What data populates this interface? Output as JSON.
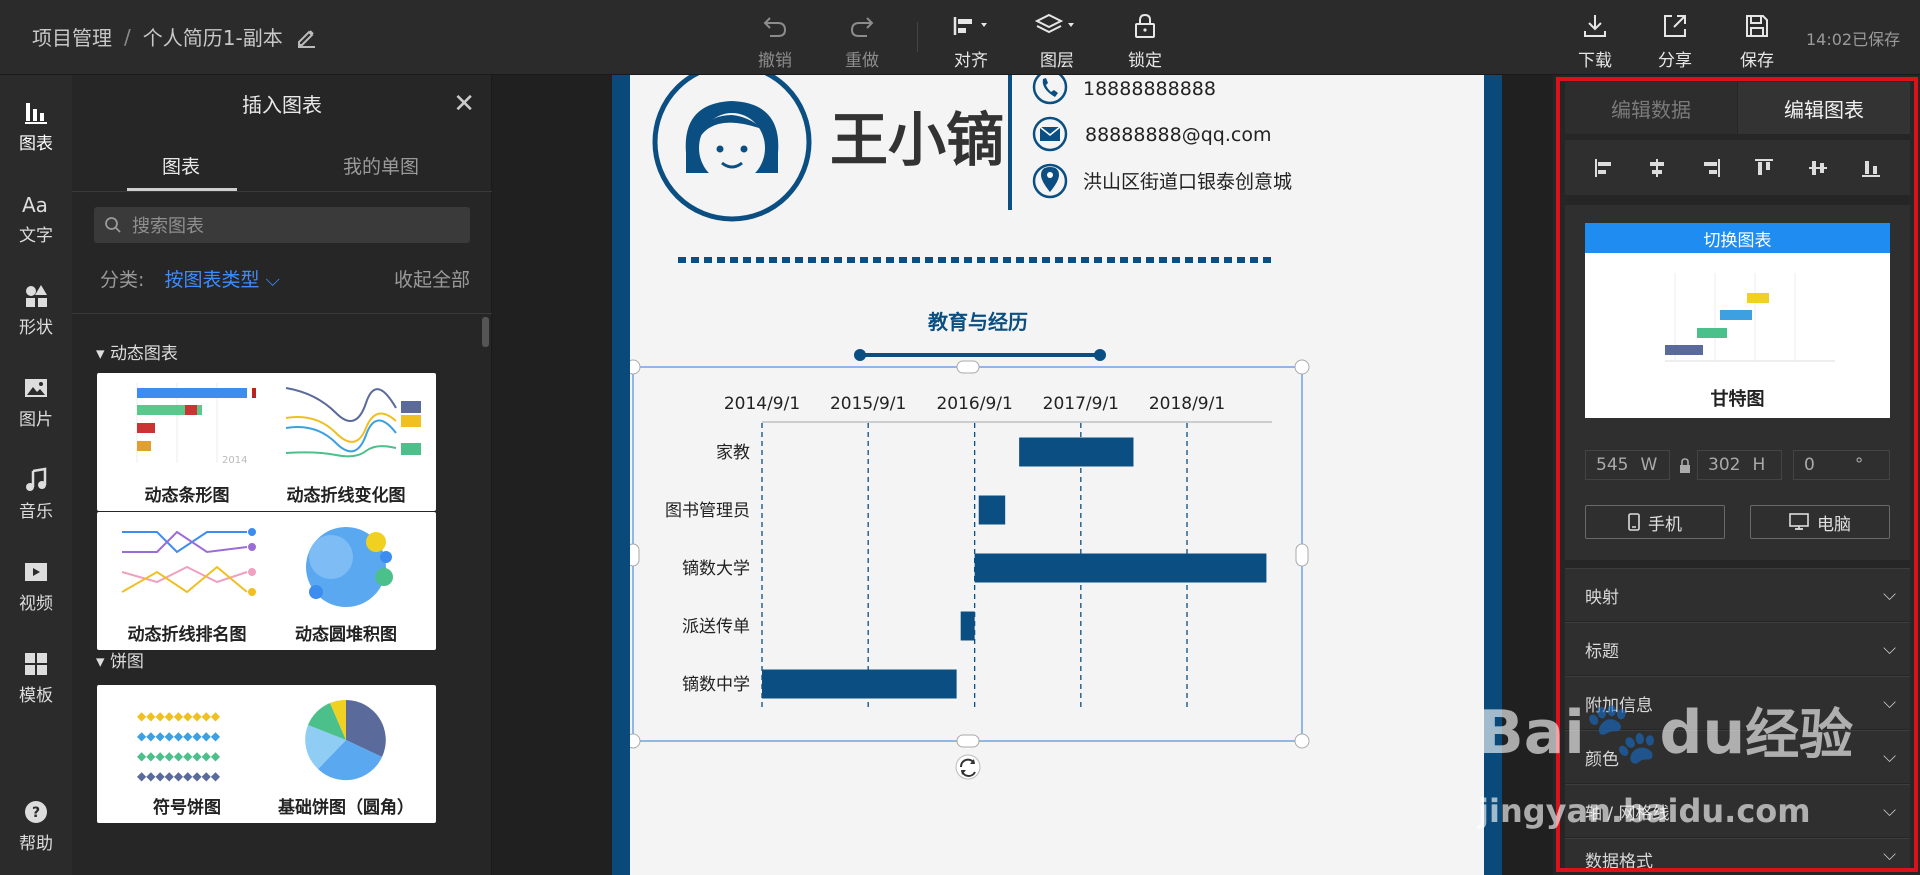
{
  "topbar": {
    "breadcrumb_root": "项目管理",
    "breadcrumb_sep": "/",
    "doc_title": "个人简历1-副本",
    "undo": "撤销",
    "redo": "重做",
    "align": "对齐",
    "layers": "图层",
    "lock": "锁定",
    "download": "下载",
    "share": "分享",
    "save": "保存",
    "saved_status": "14:02已保存"
  },
  "leftnav": {
    "items": [
      {
        "label": "图表",
        "icon": "bar-chart-icon"
      },
      {
        "label": "文字",
        "icon": "text-icon"
      },
      {
        "label": "形状",
        "icon": "shapes-icon"
      },
      {
        "label": "图片",
        "icon": "image-icon"
      },
      {
        "label": "音乐",
        "icon": "music-icon"
      },
      {
        "label": "视频",
        "icon": "video-icon"
      },
      {
        "label": "模板",
        "icon": "template-icon"
      },
      {
        "label": "帮助",
        "icon": "help-icon"
      }
    ]
  },
  "insert_panel": {
    "title": "插入图表",
    "tab_charts": "图表",
    "tab_my": "我的单图",
    "search_placeholder": "搜索图表",
    "filter_label": "分类:",
    "filter_value": "按图表类型",
    "collapse_all": "收起全部",
    "section_dynamic": "动态图表",
    "section_pie": "饼图",
    "cards": [
      "动态条形图",
      "动态折线变化图",
      "动态折线排名图",
      "动态圆堆积图",
      "符号饼图",
      "基础饼图（圆角）"
    ],
    "card_year": "2014"
  },
  "resume": {
    "name": "王小镝",
    "phone": "18888888888",
    "email": "88888888@qq.com",
    "address": "洪山区街道口银泰创意城",
    "section_title": "教育与经历"
  },
  "chart_data": {
    "type": "gantt",
    "title": "",
    "x_ticks": [
      "2014/9/1",
      "2015/9/1",
      "2016/9/1",
      "2017/9/1",
      "2018/9/1"
    ],
    "xlim": [
      "2014/9/1",
      "2019/6/1"
    ],
    "color": "#0b4f82",
    "tasks": [
      {
        "name": "家教",
        "start": "2017/2/1",
        "end": "2018/3/1"
      },
      {
        "name": "图书管理员",
        "start": "2016/9/15",
        "end": "2016/12/15"
      },
      {
        "name": "镝数大学",
        "start": "2016/9/1",
        "end": "2019/6/1"
      },
      {
        "name": "派送传单",
        "start": "2016/7/15",
        "end": "2016/9/1"
      },
      {
        "name": "镝数中学",
        "start": "2014/9/1",
        "end": "2016/7/1"
      }
    ]
  },
  "right_panel": {
    "tab_data": "编辑数据",
    "tab_chart": "编辑图表",
    "switch_chart": "切换图表",
    "chart_type_name": "甘特图",
    "width": "545",
    "width_unit": "W",
    "height": "302",
    "height_unit": "H",
    "rotation": "0",
    "rotation_unit": "°",
    "mobile": "手机",
    "desktop": "电脑",
    "sections": [
      "映射",
      "标题",
      "附加信息",
      "颜色",
      "轴 / 网格线",
      "数据格式"
    ]
  },
  "watermark": {
    "brand": "Bai",
    "brand2": "du",
    "cn": "经验",
    "url": "jingyan.baidu.com"
  }
}
